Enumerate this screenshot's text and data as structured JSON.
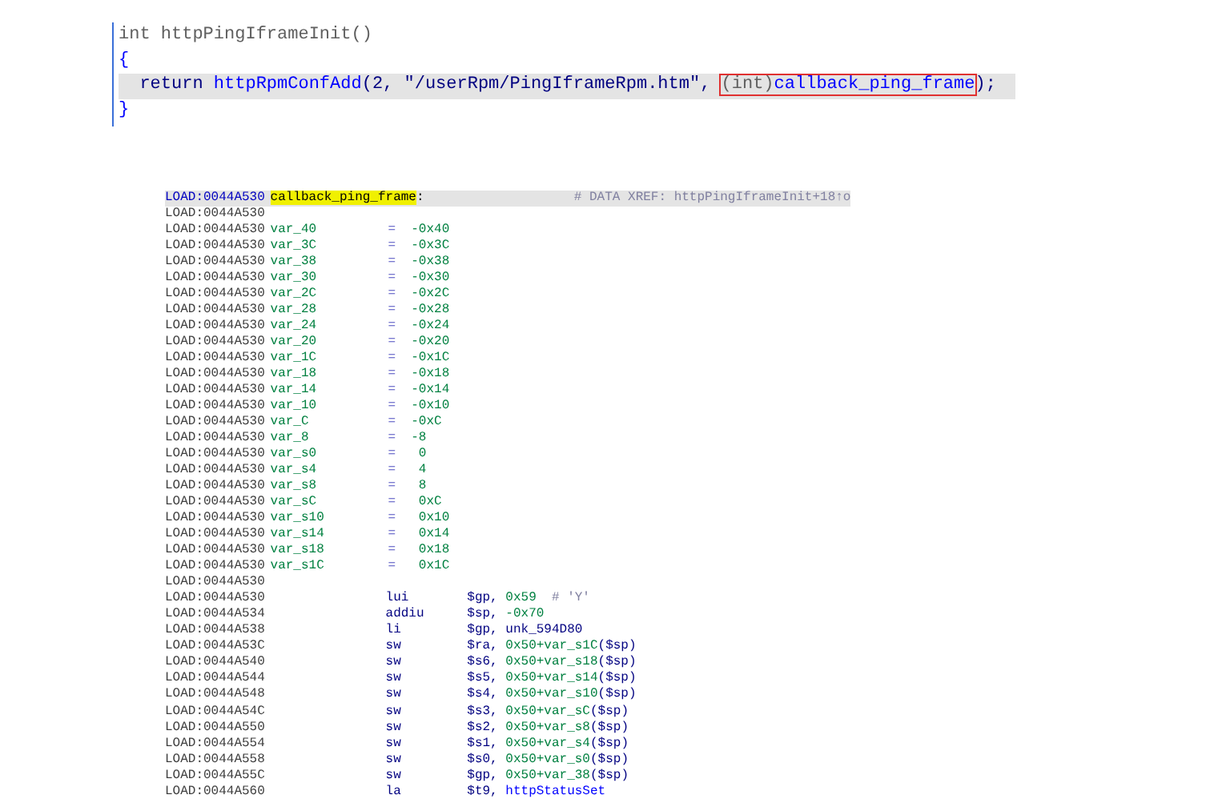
{
  "pseudocode": {
    "lines": [
      {
        "highlighted": false,
        "tokens": [
          {
            "text": "int httpPingIframeInit()",
            "kind": "muted",
            "boxed": false
          }
        ]
      },
      {
        "highlighted": false,
        "tokens": [
          {
            "text": "{",
            "kind": "brace",
            "boxed": false
          }
        ]
      },
      {
        "highlighted": true,
        "tokens": [
          {
            "text": "  return ",
            "kind": "plain",
            "boxed": false
          },
          {
            "text": "httpRpmConfAdd",
            "kind": "func",
            "boxed": false
          },
          {
            "text": "(2, \"/userRpm/PingIframeRpm.htm\", ",
            "kind": "plain",
            "boxed": false
          },
          {
            "text": "(int)",
            "kind": "muted",
            "boxed": true
          },
          {
            "text": "callback_ping_frame",
            "kind": "func",
            "boxed": true
          },
          {
            "text": ");",
            "kind": "plain",
            "boxed": false
          }
        ]
      },
      {
        "highlighted": false,
        "tokens": [
          {
            "text": "}",
            "kind": "brace",
            "boxed": false
          }
        ]
      }
    ]
  },
  "listing": {
    "rows": [
      {
        "kind": "label",
        "address": "LOAD:0044A530",
        "label": "callback_ping_frame",
        "marked": true,
        "punct": ":",
        "highlighted": true,
        "comment": "# DATA XREF: httpPingIframeInit+18↑o"
      },
      {
        "kind": "blank",
        "address": "LOAD:0044A530",
        "highlighted": false
      },
      {
        "kind": "var",
        "address": "LOAD:0044A530",
        "name": "var_40",
        "equals": "=",
        "value": "-0x40",
        "highlighted": false
      },
      {
        "kind": "var",
        "address": "LOAD:0044A530",
        "name": "var_3C",
        "equals": "=",
        "value": "-0x3C",
        "highlighted": false
      },
      {
        "kind": "var",
        "address": "LOAD:0044A530",
        "name": "var_38",
        "equals": "=",
        "value": "-0x38",
        "highlighted": false
      },
      {
        "kind": "var",
        "address": "LOAD:0044A530",
        "name": "var_30",
        "equals": "=",
        "value": "-0x30",
        "highlighted": false
      },
      {
        "kind": "var",
        "address": "LOAD:0044A530",
        "name": "var_2C",
        "equals": "=",
        "value": "-0x2C",
        "highlighted": false
      },
      {
        "kind": "var",
        "address": "LOAD:0044A530",
        "name": "var_28",
        "equals": "=",
        "value": "-0x28",
        "highlighted": false
      },
      {
        "kind": "var",
        "address": "LOAD:0044A530",
        "name": "var_24",
        "equals": "=",
        "value": "-0x24",
        "highlighted": false
      },
      {
        "kind": "var",
        "address": "LOAD:0044A530",
        "name": "var_20",
        "equals": "=",
        "value": "-0x20",
        "highlighted": false
      },
      {
        "kind": "var",
        "address": "LOAD:0044A530",
        "name": "var_1C",
        "equals": "=",
        "value": "-0x1C",
        "highlighted": false
      },
      {
        "kind": "var",
        "address": "LOAD:0044A530",
        "name": "var_18",
        "equals": "=",
        "value": "-0x18",
        "highlighted": false
      },
      {
        "kind": "var",
        "address": "LOAD:0044A530",
        "name": "var_14",
        "equals": "=",
        "value": "-0x14",
        "highlighted": false
      },
      {
        "kind": "var",
        "address": "LOAD:0044A530",
        "name": "var_10",
        "equals": "=",
        "value": "-0x10",
        "highlighted": false
      },
      {
        "kind": "var",
        "address": "LOAD:0044A530",
        "name": "var_C",
        "equals": "=",
        "value": "-0xC",
        "highlighted": false
      },
      {
        "kind": "var",
        "address": "LOAD:0044A530",
        "name": "var_8",
        "equals": "=",
        "value": "-8",
        "highlighted": false
      },
      {
        "kind": "var",
        "address": "LOAD:0044A530",
        "name": "var_s0",
        "equals": "=",
        "value": " 0",
        "highlighted": false
      },
      {
        "kind": "var",
        "address": "LOAD:0044A530",
        "name": "var_s4",
        "equals": "=",
        "value": " 4",
        "highlighted": false
      },
      {
        "kind": "var",
        "address": "LOAD:0044A530",
        "name": "var_s8",
        "equals": "=",
        "value": " 8",
        "highlighted": false
      },
      {
        "kind": "var",
        "address": "LOAD:0044A530",
        "name": "var_sC",
        "equals": "=",
        "value": " 0xC",
        "highlighted": false
      },
      {
        "kind": "var",
        "address": "LOAD:0044A530",
        "name": "var_s10",
        "equals": "=",
        "value": " 0x10",
        "highlighted": false
      },
      {
        "kind": "var",
        "address": "LOAD:0044A530",
        "name": "var_s14",
        "equals": "=",
        "value": " 0x14",
        "highlighted": false
      },
      {
        "kind": "var",
        "address": "LOAD:0044A530",
        "name": "var_s18",
        "equals": "=",
        "value": " 0x18",
        "highlighted": false
      },
      {
        "kind": "var",
        "address": "LOAD:0044A530",
        "name": "var_s1C",
        "equals": "=",
        "value": " 0x1C",
        "highlighted": false
      },
      {
        "kind": "blank",
        "address": "LOAD:0044A530",
        "highlighted": false
      },
      {
        "kind": "insn",
        "address": "LOAD:0044A530",
        "mnemonic": "lui",
        "operands": [
          {
            "text": "$gp, ",
            "kind": "reg"
          },
          {
            "text": "0x59",
            "kind": "num"
          },
          {
            "text": "  # 'Y'",
            "kind": "comment"
          }
        ],
        "highlighted": false
      },
      {
        "kind": "insn",
        "address": "LOAD:0044A534",
        "mnemonic": "addiu",
        "operands": [
          {
            "text": "$sp, ",
            "kind": "reg"
          },
          {
            "text": "-0x70",
            "kind": "num"
          }
        ],
        "highlighted": false
      },
      {
        "kind": "insn",
        "address": "LOAD:0044A538",
        "mnemonic": "li",
        "operands": [
          {
            "text": "$gp, unk_594D80",
            "kind": "reg"
          }
        ],
        "highlighted": false
      },
      {
        "kind": "insn",
        "address": "LOAD:0044A53C",
        "mnemonic": "sw",
        "operands": [
          {
            "text": "$ra, ",
            "kind": "reg"
          },
          {
            "text": "0x50+var_s1C",
            "kind": "num"
          },
          {
            "text": "($sp)",
            "kind": "reg"
          }
        ],
        "highlighted": false
      },
      {
        "kind": "insn",
        "address": "LOAD:0044A540",
        "mnemonic": "sw",
        "operands": [
          {
            "text": "$s6, ",
            "kind": "reg"
          },
          {
            "text": "0x50+var_s18",
            "kind": "num"
          },
          {
            "text": "($sp)",
            "kind": "reg"
          }
        ],
        "highlighted": false
      },
      {
        "kind": "insn",
        "address": "LOAD:0044A544",
        "mnemonic": "sw",
        "operands": [
          {
            "text": "$s5, ",
            "kind": "reg"
          },
          {
            "text": "0x50+var_s14",
            "kind": "num"
          },
          {
            "text": "($sp)",
            "kind": "reg"
          }
        ],
        "highlighted": false
      },
      {
        "kind": "insn",
        "address": "LOAD:0044A548",
        "mnemonic": "sw",
        "operands": [
          {
            "text": "$s4, ",
            "kind": "reg"
          },
          {
            "text": "0x50+var_s10",
            "kind": "num"
          },
          {
            "text": "($sp)",
            "kind": "reg"
          }
        ],
        "highlighted": false
      },
      {
        "kind": "insn",
        "address": "LOAD:0044A54C",
        "mnemonic": "sw",
        "operands": [
          {
            "text": "$s3, ",
            "kind": "reg"
          },
          {
            "text": "0x50+var_sC",
            "kind": "num"
          },
          {
            "text": "($sp)",
            "kind": "reg"
          }
        ],
        "highlighted": false
      },
      {
        "kind": "insn",
        "address": "LOAD:0044A550",
        "mnemonic": "sw",
        "operands": [
          {
            "text": "$s2, ",
            "kind": "reg"
          },
          {
            "text": "0x50+var_s8",
            "kind": "num"
          },
          {
            "text": "($sp)",
            "kind": "reg"
          }
        ],
        "highlighted": false
      },
      {
        "kind": "insn",
        "address": "LOAD:0044A554",
        "mnemonic": "sw",
        "operands": [
          {
            "text": "$s1, ",
            "kind": "reg"
          },
          {
            "text": "0x50+var_s4",
            "kind": "num"
          },
          {
            "text": "($sp)",
            "kind": "reg"
          }
        ],
        "highlighted": false
      },
      {
        "kind": "insn",
        "address": "LOAD:0044A558",
        "mnemonic": "sw",
        "operands": [
          {
            "text": "$s0, ",
            "kind": "reg"
          },
          {
            "text": "0x50+var_s0",
            "kind": "num"
          },
          {
            "text": "($sp)",
            "kind": "reg"
          }
        ],
        "highlighted": false
      },
      {
        "kind": "insn",
        "address": "LOAD:0044A55C",
        "mnemonic": "sw",
        "operands": [
          {
            "text": "$gp, ",
            "kind": "reg"
          },
          {
            "text": "0x50+var_38",
            "kind": "num"
          },
          {
            "text": "($sp)",
            "kind": "reg"
          }
        ],
        "highlighted": false
      },
      {
        "kind": "insn",
        "address": "LOAD:0044A560",
        "mnemonic": "la",
        "operands": [
          {
            "text": "$t9, ",
            "kind": "reg"
          },
          {
            "text": "httpStatusSet",
            "kind": "name"
          }
        ],
        "highlighted": false
      }
    ]
  }
}
